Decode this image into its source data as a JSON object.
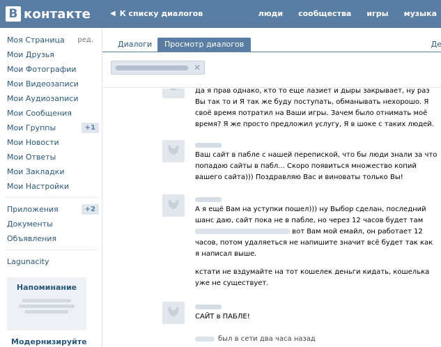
{
  "header": {
    "logo_letter": "В",
    "logo_text": "контакте",
    "back_link": "К списку диалогов",
    "nav": [
      "люди",
      "сообщества",
      "игры",
      "музыка"
    ]
  },
  "sidebar": {
    "items": [
      {
        "label": "Моя Страница",
        "extra": "ред."
      },
      {
        "label": "Мои Друзья"
      },
      {
        "label": "Мои Фотографии"
      },
      {
        "label": "Мои Видеозаписи"
      },
      {
        "label": "Мои Аудиозаписи"
      },
      {
        "label": "Мои Сообщения"
      },
      {
        "label": "Мои Группы",
        "badge": "+1"
      },
      {
        "label": "Мои Новости"
      },
      {
        "label": "Мои Ответы"
      },
      {
        "label": "Мои Закладки"
      },
      {
        "label": "Мои Настройки"
      }
    ],
    "items2": [
      {
        "label": "Приложения",
        "badge": "+2"
      },
      {
        "label": "Документы"
      },
      {
        "label": "Объявления"
      }
    ],
    "extra_link": "Lagunacity",
    "reminder_title": "Напоминание",
    "modernize": "Модернизируйте"
  },
  "tabs": {
    "dialogs": "Диалоги",
    "view": "Просмотр диалогов",
    "right": "Де"
  },
  "messages": [
    {
      "text": "Да я прав однако, кто то ещё лазиет и дыры закрывает, ну раз Вы так то и Я так же буду поступать, обманывать нехорошо. Я своё время потратил на Ваши игры. Зачем было отнимать моё время? Я же просто предложил услугу, Я в шоке с таких людей."
    },
    {
      "text": "Ваш сайт в пабле с нашей перепиской, что бы люди знали за что попадаю сайты в пабл... Скоро появиться множество копий вашего сайта))) Поздравляю Вас и виноваты только Вы!"
    },
    {
      "text_a": "А я ещё Вам на уступки пошел))) ну Выбор сделан, последний шанс даю, сайт пока не в пабле, но через 12 часов будет там",
      "text_b": " вот Вам мой емайл, он работает 12 часов, потом удаляеться не напишите значит всё будет так как я написал выше.",
      "text_c": "кстати не вздумайте на тот кошелек деньги кидать, кошелька уже не существует."
    },
    {
      "text": "САЙТ в ПАБЛЕ!"
    }
  ],
  "status": "был в сети два часа назад",
  "colors": {
    "header": "#597da3",
    "link": "#2b587a",
    "tab_active": "#597da3"
  }
}
